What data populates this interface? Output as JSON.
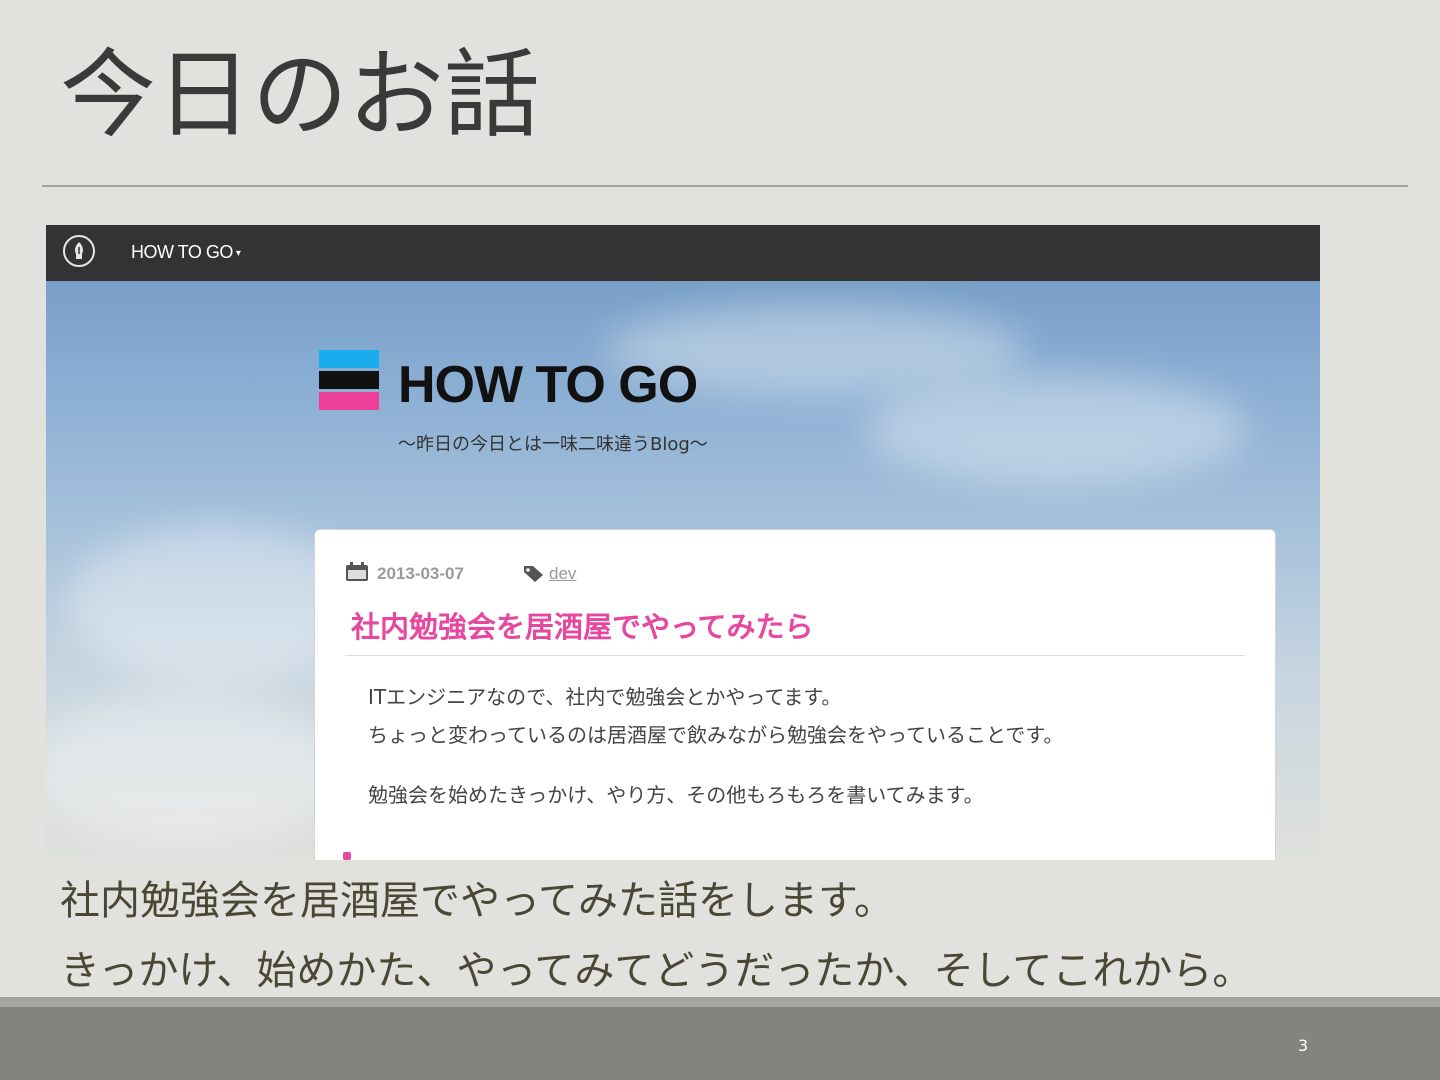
{
  "slide": {
    "title": "今日のお話",
    "caption_lines": [
      "社内勉強会を居酒屋でやってみた話をします。",
      "きっかけ、始めかた、やってみてどうだったか、そしてこれから。"
    ],
    "page_number": "3"
  },
  "browser": {
    "navbar": {
      "brand_label": "HOW TO GO",
      "caret": "▾",
      "logo_icon": "pen-nib-icon"
    },
    "blog": {
      "title": "HOW TO GO",
      "subtitle": "～昨日の今日とは一味二味違うBlog～",
      "logo_colors": [
        "#1aacec",
        "#111111",
        "#ec3f99"
      ]
    },
    "post": {
      "date": "2013-03-07",
      "tag": "dev",
      "title": "社内勉強会を居酒屋でやってみたら",
      "paragraphs": [
        "ITエンジニアなので、社内で勉強会とかやってます。",
        "ちょっと変わっているのは居酒屋で飲みながら勉強会をやっていることです。",
        "勉強会を始めたきっかけ、やり方、その他もろもろを書いてみます。"
      ]
    }
  },
  "colors": {
    "accent_pink": "#e6479f",
    "navbar_bg": "#333333",
    "slide_bg": "#e1e2dd",
    "footer_bg": "#83847d"
  }
}
